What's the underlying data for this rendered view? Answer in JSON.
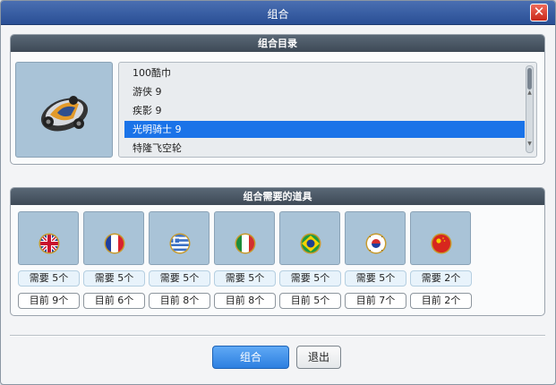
{
  "window": {
    "title": "组合",
    "close_glyph": "✕"
  },
  "catalog": {
    "header": "组合目录",
    "items": [
      {
        "label": "100酷巾"
      },
      {
        "label": "游侠 9"
      },
      {
        "label": "疾影 9"
      },
      {
        "label": "光明骑士 9",
        "selected": true
      },
      {
        "label": "特隆飞空轮"
      }
    ]
  },
  "required": {
    "header": "组合需要的道具",
    "items": [
      {
        "flag": "uk-flag-icon",
        "need": "需要 5个",
        "have": "目前 9个"
      },
      {
        "flag": "france-flag-icon",
        "need": "需要 5个",
        "have": "目前 6个"
      },
      {
        "flag": "greece-flag-icon",
        "need": "需要 5个",
        "have": "目前 8个"
      },
      {
        "flag": "italy-flag-icon",
        "need": "需要 5个",
        "have": "目前 8个"
      },
      {
        "flag": "brazil-flag-icon",
        "need": "需要 5个",
        "have": "目前 5个"
      },
      {
        "flag": "korea-flag-icon",
        "need": "需要 5个",
        "have": "目前 7个"
      },
      {
        "flag": "china-flag-icon",
        "need": "需要 2个",
        "have": "目前 2个"
      }
    ]
  },
  "buttons": {
    "combine": "组合",
    "exit": "退出"
  },
  "colors": {
    "titlebar": "#2a4f95",
    "selection": "#1a73e8",
    "tile": "#a9c3d7",
    "close": "#c8281a"
  }
}
